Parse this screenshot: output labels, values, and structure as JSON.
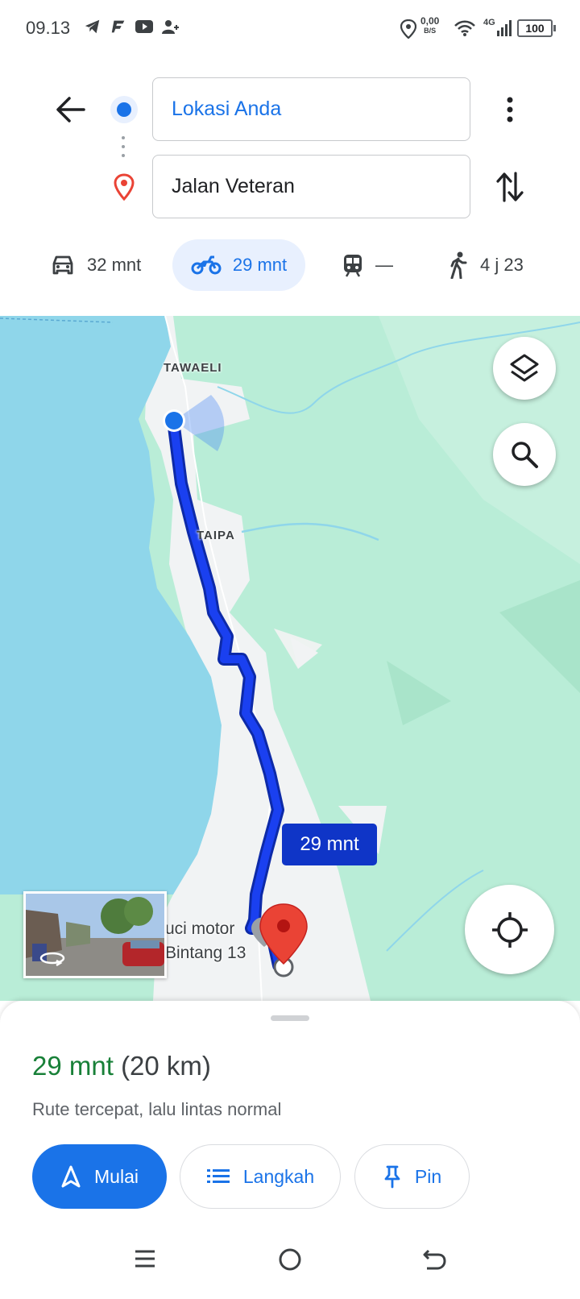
{
  "status_bar": {
    "time": "09.13",
    "net_speed_value": "0,00",
    "net_speed_unit": "B/S",
    "network_type": "4G",
    "battery": "100",
    "icons": [
      "telegram-icon",
      "app-f-icon",
      "youtube-icon",
      "add-contact-icon",
      "location-icon",
      "wifi-icon",
      "signal-icon",
      "battery-icon"
    ]
  },
  "directions": {
    "origin": "Lokasi Anda",
    "destination": "Jalan Veteran"
  },
  "modes": [
    {
      "name": "car",
      "label": "32 mnt",
      "active": false
    },
    {
      "name": "motorcycle",
      "label": "29 mnt",
      "active": true
    },
    {
      "name": "transit",
      "label": "—",
      "active": false
    },
    {
      "name": "walk",
      "label": "4 j 23",
      "active": false
    }
  ],
  "map": {
    "labels": {
      "town_1": "TAWAELI",
      "town_2": "TAIPA"
    },
    "route_badge": "29 mnt",
    "place_line_1": "uci motor",
    "place_line_2": "Bintang 13",
    "colors": {
      "water": "#8fd6ea",
      "land": "#b9edd7",
      "route": "#1a33d6",
      "pin": "#ea4335"
    }
  },
  "sheet": {
    "time": "29 mnt",
    "distance": "(20 km)",
    "description": "Rute tercepat, lalu lintas normal",
    "start_label": "Mulai",
    "steps_label": "Langkah",
    "pin_label": "Pin"
  },
  "colors": {
    "accent": "#1a73e8",
    "time_green": "#188038",
    "active_tab_bg": "#e8f0fe"
  }
}
